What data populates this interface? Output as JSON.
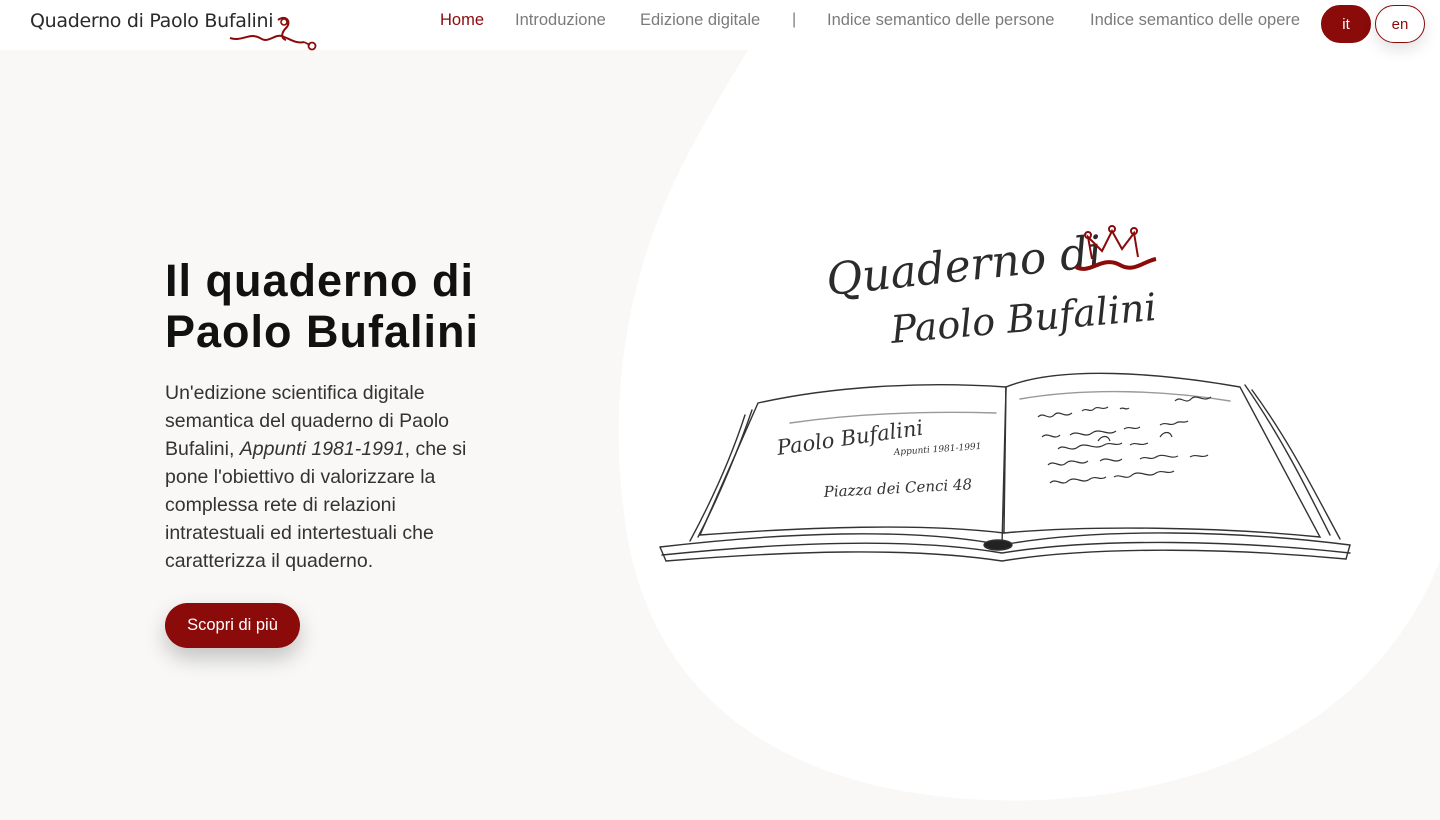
{
  "header": {
    "brand": "Quaderno di Paolo Bufalini",
    "nav": [
      {
        "label": "Home",
        "active": true
      },
      {
        "label": "Introduzione",
        "active": false
      },
      {
        "label": "Edizione digitale",
        "active": false
      },
      {
        "label": "Indice semantico delle persone",
        "active": false
      },
      {
        "label": "Indice semantico delle opere",
        "active": false
      }
    ],
    "separator": "|",
    "languages": [
      {
        "label": "it",
        "active": true
      },
      {
        "label": "en",
        "active": false
      }
    ]
  },
  "hero": {
    "title_line1": "Il quaderno di",
    "title_line2": "Paolo Bufalini",
    "desc_before": "Un'edizione scientifica digitale semantica del quaderno di Paolo Bufalini, ",
    "desc_italic": "Appunti 1981-1991",
    "desc_after": ", che si pone l'obiettivo di valorizzare la complessa rete di relazioni intratestuali ed intertestuali che caratterizza il quaderno.",
    "cta_label": "Scopri di più"
  },
  "illustration": {
    "logo_line1": "Quaderno di",
    "logo_line2": "Paolo Bufalini",
    "page_left_name": "Paolo Bufalini",
    "page_left_subtitle": "Appunti 1981-1991",
    "page_left_address": "Piazza dei Cenci 48"
  },
  "colors": {
    "accent": "#8b0a0a",
    "background": "#f9f8f6",
    "nav_text": "#7b7b7b"
  }
}
